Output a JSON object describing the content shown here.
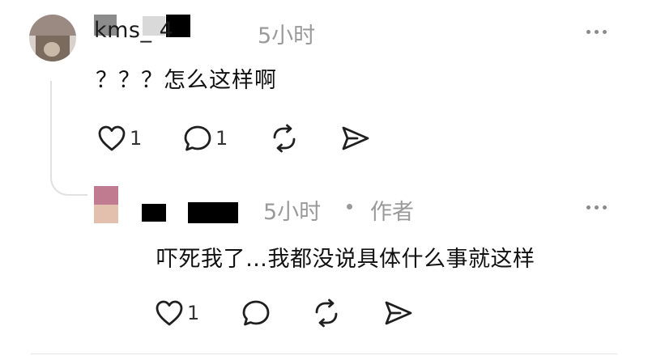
{
  "comment": {
    "username": "kms_   4",
    "time": "5小时",
    "text": "？？？怎么这样啊",
    "likes": "1",
    "replies": "1"
  },
  "reply": {
    "time": "5小时",
    "separator": "•",
    "author_tag": "作者",
    "text": "吓死我了…我都没说具体什么事就这样",
    "likes": "1"
  },
  "icons": {
    "like": "heart-icon",
    "comment": "comment-bubble-icon",
    "repost": "repost-icon",
    "share": "send-icon",
    "more": "more-horizontal-icon"
  },
  "colors": {
    "text": "#111111",
    "muted": "#9a9a9a",
    "icon": "#1f1f1f",
    "divider": "#e5e5e5"
  }
}
